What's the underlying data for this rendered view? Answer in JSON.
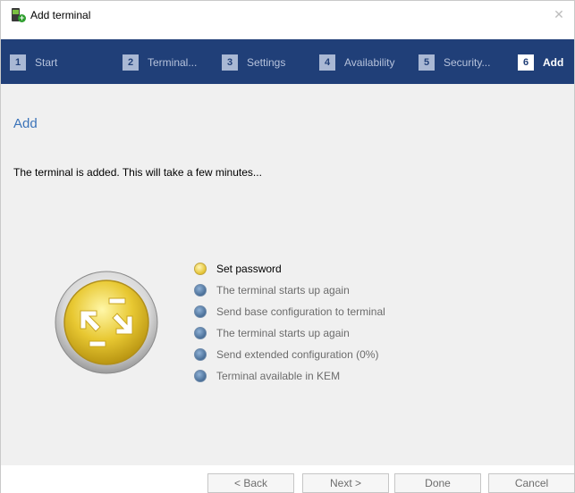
{
  "window": {
    "title": "Add terminal"
  },
  "steps": [
    {
      "num": "1",
      "label": "Start"
    },
    {
      "num": "2",
      "label": "Terminal..."
    },
    {
      "num": "3",
      "label": "Settings"
    },
    {
      "num": "4",
      "label": "Availability"
    },
    {
      "num": "5",
      "label": "Security..."
    },
    {
      "num": "6",
      "label": "Add"
    }
  ],
  "active_step": 6,
  "main": {
    "heading": "Add",
    "message": "The terminal is added. This will take a few minutes...",
    "progress": [
      {
        "label": "Set password",
        "state": "active"
      },
      {
        "label": "The terminal starts up again",
        "state": "pending"
      },
      {
        "label": "Send base configuration to terminal",
        "state": "pending"
      },
      {
        "label": "The terminal starts up again",
        "state": "pending"
      },
      {
        "label": "Send extended configuration (0%)",
        "state": "pending"
      },
      {
        "label": "Terminal available in KEM",
        "state": "pending"
      }
    ]
  },
  "buttons": {
    "back": "< Back",
    "next": "Next >",
    "done": "Done",
    "cancel": "Cancel"
  },
  "colors": {
    "stepbar": "#203f78",
    "heading": "#3b73b9",
    "content_bg": "#f0f0f0"
  }
}
